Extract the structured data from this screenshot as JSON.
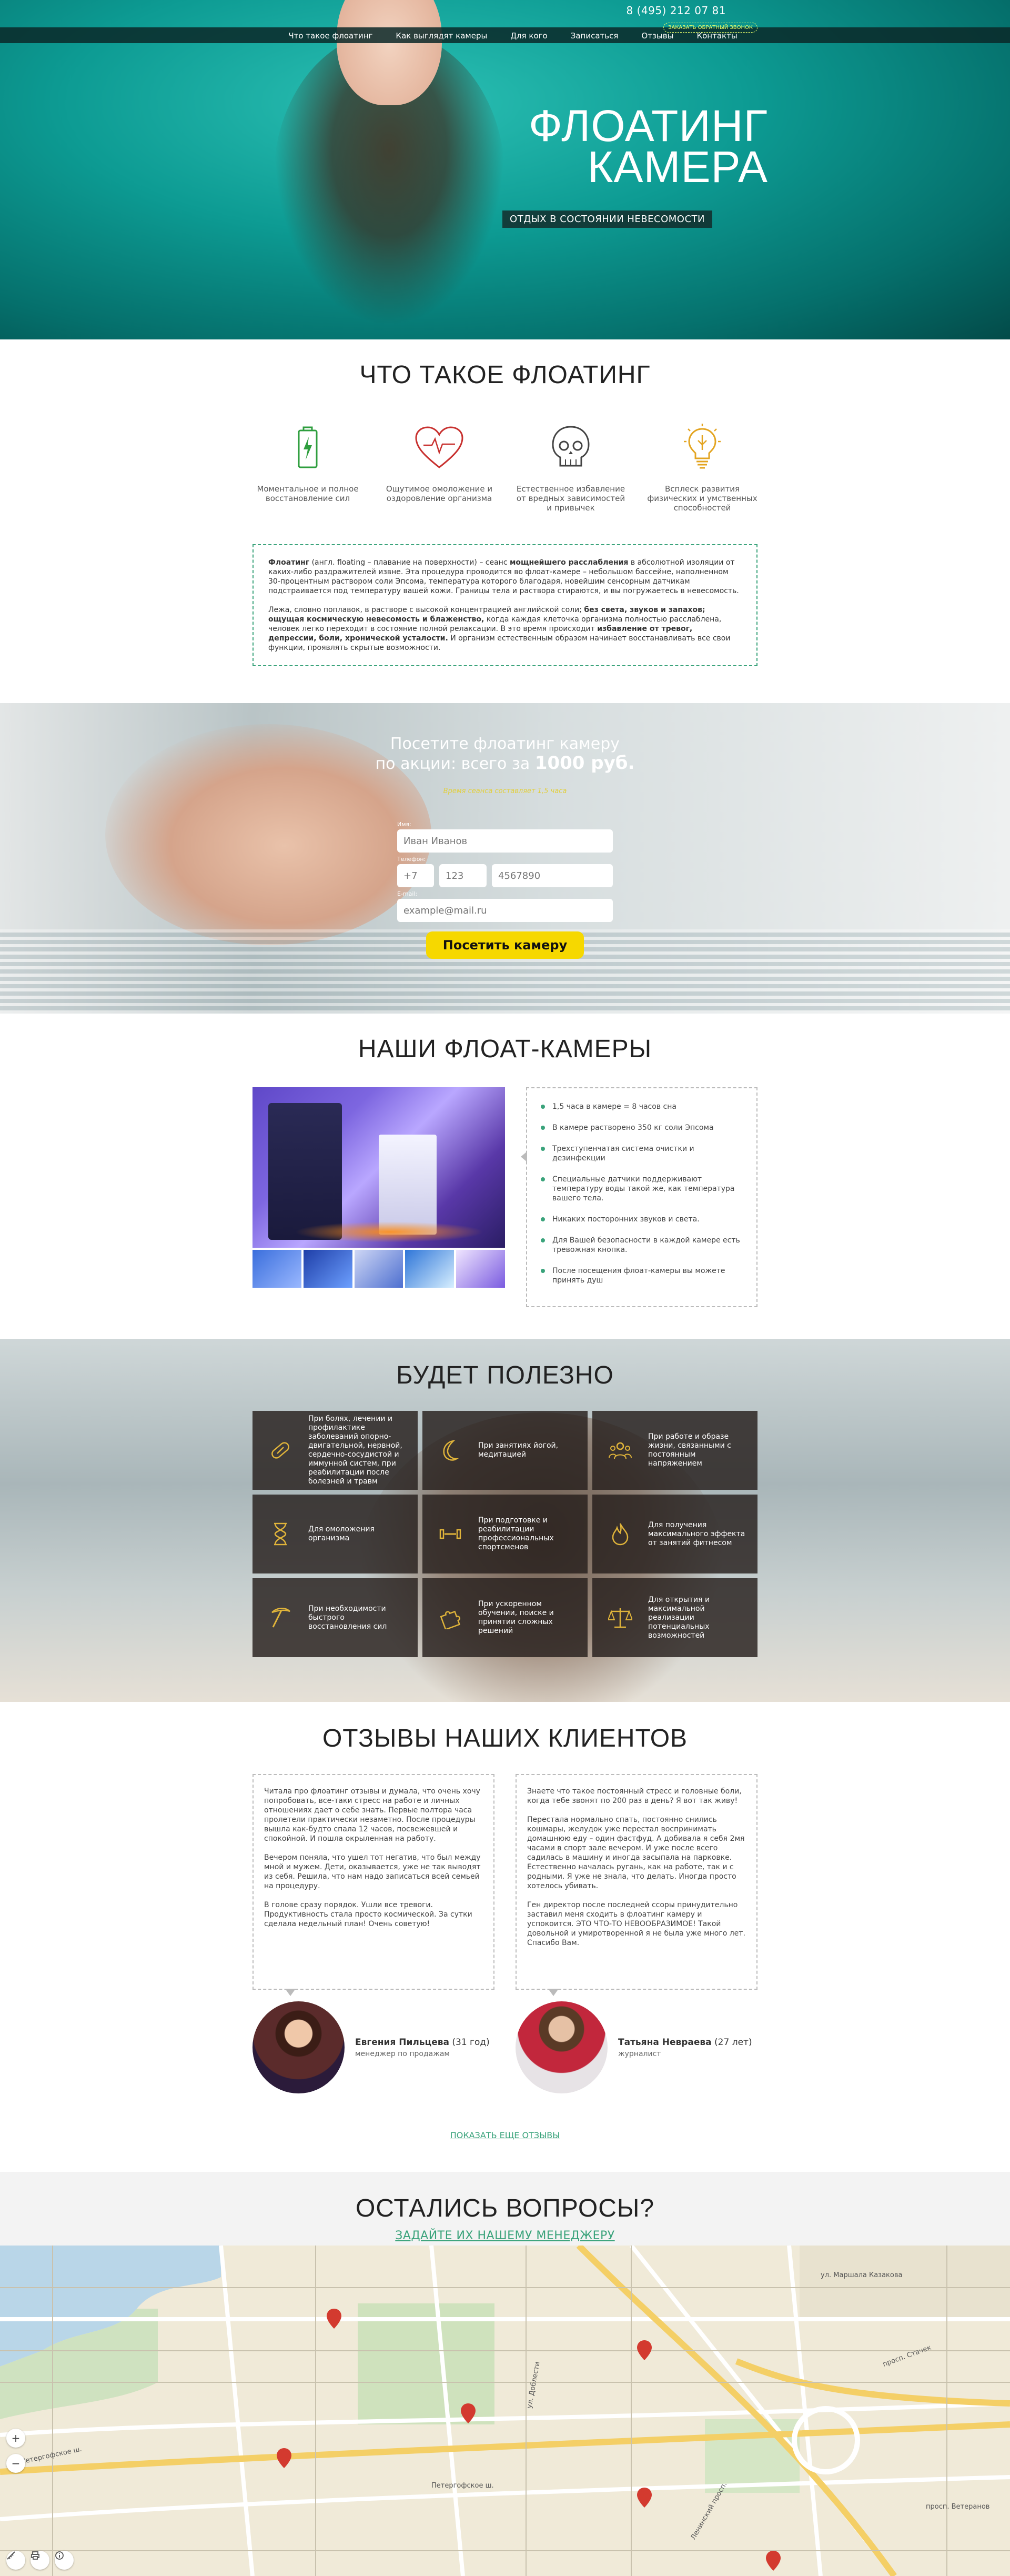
{
  "header": {
    "phone": "8 (495) 212 07 81",
    "callback": "ЗАКАЗАТЬ ОБРАТНЫЙ ЗВОНОК",
    "nav": [
      "Что такое флоатинг",
      "Как выглядят камеры",
      "Для кого",
      "Записаться",
      "Отзывы",
      "Контакты"
    ]
  },
  "hero": {
    "title_line1": "ФЛОАТИНГ",
    "title_line2": "КАМЕРА",
    "subtitle": "ОТДЫХ В СОСТОЯНИИ НЕВЕСОМОСТИ"
  },
  "what": {
    "title": "ЧТО ТАКОЕ ФЛОАТИНГ",
    "benefits": [
      {
        "icon": "battery-icon",
        "caption": "Моментальное и полное восстановление сил"
      },
      {
        "icon": "heart-icon",
        "caption": "Ощутимое омоложение и оздоровление организма"
      },
      {
        "icon": "skull-icon",
        "caption": "Естественное избавление от вредных зависимостей и привычек"
      },
      {
        "icon": "lightbulb-icon",
        "caption": "Всплеск развития физических и умственных способностей"
      }
    ],
    "def_p1_b1": "Флоатинг",
    "def_p1_t1": " (англ. floating – плавание на поверхности) – сеанс ",
    "def_p1_b2": "мощнейшего расслабления",
    "def_p1_t2": " в абсолютной изоляции от каких-либо раздражителей извне. Эта процедура проводится во флоат-камере – небольшом бассейне, наполненном 30-процентным раствором соли Эпсома, температура которого благодаря, новейшим сенсорным датчикам подстраивается под температуру вашей кожи. Границы тела и раствора стираются, и вы погружаетесь в невесомость.",
    "def_p2_t1": "Лежа, словно поплавок, в растворе с высокой концентрацией английской соли; ",
    "def_p2_b1": "без света, звуков и запахов; ощущая космическую невесомость и блаженство,",
    "def_p2_t2": " когда каждая клеточка организма полностью расслаблена, человек легко переходит в состояние полной релаксации. В это время происходит ",
    "def_p2_b2": "избавление от тревог, депрессии, боли, хронической усталости.",
    "def_p2_t3": " И организм естественным образом начинает восстанавливать все свои функции, проявлять скрытые возможности."
  },
  "promo": {
    "line1": "Посетите флоатинг камеру",
    "line2": "по акции: всего за ",
    "price": "1000 руб.",
    "duration": "Время сеанса составляет 1,5 часа",
    "name_label": "Имя:",
    "name_placeholder": "Иван Иванов",
    "phone_label": "Телефон:",
    "phone_code_placeholder": "+7",
    "phone_area_placeholder": "123",
    "phone_number_placeholder": "4567890",
    "email_label": "E-mail:",
    "email_placeholder": "example@mail.ru",
    "submit": "Посетить камеру"
  },
  "cams": {
    "title": "НАШИ ФЛОАТ-КАМЕРЫ",
    "features": [
      "1,5 часа в камере = 8 часов сна",
      "В камере растворено  350 кг соли Эпсома",
      "Трехступенчатая система очистки и дезинфекции",
      "Специальные датчики поддерживают температуру воды такой же, как температура вашего тела.",
      "Никаких посторонних звуков и света.",
      "Для Вашей безопасности в каждой камере есть тревожная кнопка.",
      "После посещения флоат-камеры вы можете принять душ"
    ]
  },
  "useful": {
    "title": "БУДЕТ ПОЛЕЗНО",
    "items": [
      {
        "icon": "pill-icon",
        "text": "При болях, лечении и профилактике заболеваний опорно-двигательной, нервной, сердечно-сосудистой и иммунной систем, при реабилитации после болезней и травм"
      },
      {
        "icon": "moon-icon",
        "text": "При занятиях йогой, медитацией"
      },
      {
        "icon": "people-icon",
        "text": "При работе и образе жизни, связанными с постоянным напряжением"
      },
      {
        "icon": "hourglass-icon",
        "text": "Для омоложения организма"
      },
      {
        "icon": "dumbbell-icon",
        "text": "При подготовке и реабилитации профессиональных спортсменов"
      },
      {
        "icon": "flame-icon",
        "text": "Для получения максимального эффекта от занятий фитнесом"
      },
      {
        "icon": "pickaxe-icon",
        "text": "При необходимости быстрого восстановления сил"
      },
      {
        "icon": "puzzle-icon",
        "text": "При ускоренном обучении, поиске и принятии сложных решений"
      },
      {
        "icon": "scales-icon",
        "text": "Для открытия и максимальной реализации потенциальных возможностей"
      }
    ]
  },
  "reviews": {
    "title": "ОТЗЫВЫ НАШИХ КЛИЕНТОВ",
    "items": [
      {
        "p1": "Читала про флоатинг отзывы и думала, что очень хочу попробовать, все-таки стресс на работе и личных отношениях дает о себе знать. Первые полтора часа пролетели практически незаметно. После процедуры вышла как-будто спала 12 часов, посвежевшей и спокойной. И пошла окрыленная на работу.",
        "p2": "Вечером поняла, что ушел тот негатив, что был между мной и мужем. Дети, оказывается, уже не так выводят из себя. Решила, что нам надо записаться всей семьей на процедуру.",
        "p3": "В голове сразу порядок. Ушли все тревоги. Продуктивность стала просто космической. За сутки сделала недельный план! Очень советую!",
        "name": "Евгения Пильцева",
        "age": " (31 год)",
        "role": "менеджер по продажам"
      },
      {
        "p1": "Знаете что такое постоянный стресс и головные боли, когда тебе звонят по 200 раз в день? Я вот так живу!",
        "p2": "Перестала нормально спать, постоянно снились кошмары, желудок уже перестал воспринимать домашнюю еду – один фастфуд. А добивала я себя 2мя часами в спорт зале вечером. И уже после всего садилась в машину и иногда засыпала на парковке. Естественно началась ругань, как на работе, так и с родными. Я уже не знала, что делать. Иногда просто хотелось убивать.",
        "p3": "Ген директор после последней ссоры принудительно заставил меня сходить в флоатинг камеру и успокоится. ЭТО ЧТО-ТО НЕВООБРАЗИМОЕ! Такой довольной и умиротворенной я не была уже много лет. Спасибо Вам.",
        "name": "Татьяна Невраева",
        "age": " (27 лет)",
        "role": "журналист"
      }
    ],
    "more": "ПОКАЗАТЬ ЕЩЕ ОТЗЫВЫ"
  },
  "questions": {
    "title": "ОСТАЛИСЬ ВОПРОСЫ?",
    "link": "ЗАДАЙТЕ ИХ НАШЕМУ МЕНЕДЖЕРУ"
  },
  "map": {
    "streets": [
      "ул. Маршала Казакова",
      "Петергофское ш.",
      "просп. Стачек",
      "Ленинский просп.",
      "просп. Ветеранов",
      "ул. Доблести",
      "Петергофское ш."
    ],
    "zoom_in": "+",
    "zoom_out": "−"
  }
}
